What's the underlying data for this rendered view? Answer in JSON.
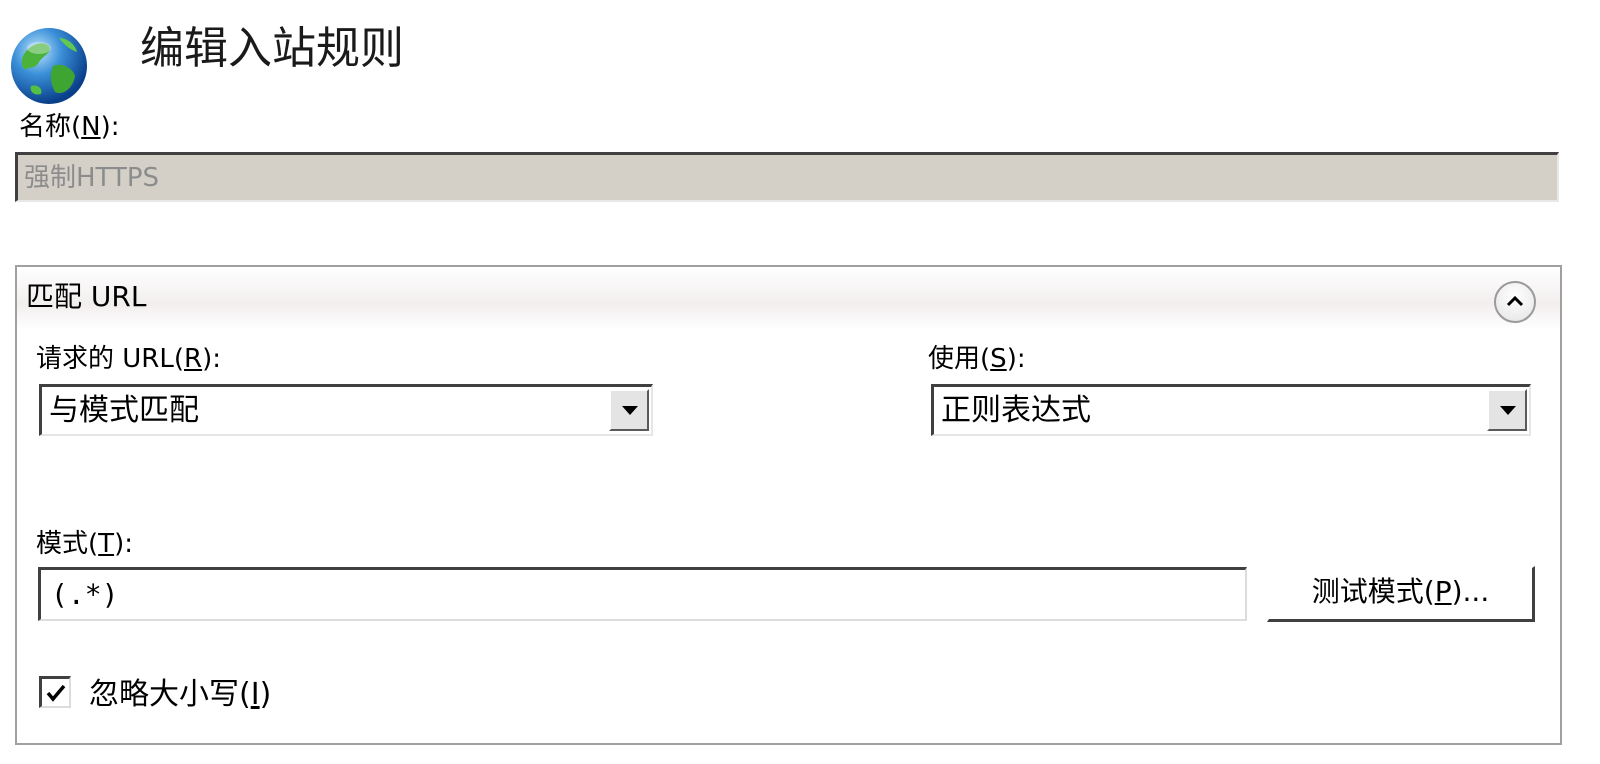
{
  "header": {
    "icon": "globe-icon",
    "title": "编辑入站规则"
  },
  "name": {
    "label": "名称",
    "mnemonic": "N",
    "value": "强制HTTPS",
    "disabled": true
  },
  "match_url": {
    "title": "匹配 URL",
    "collapse_icon": "chevron-up-icon",
    "requested_url": {
      "label": "请求的 URL",
      "mnemonic": "R",
      "value": "与模式匹配"
    },
    "using": {
      "label": "使用",
      "mnemonic": "S",
      "value": "正则表达式"
    },
    "pattern": {
      "label": "模式",
      "mnemonic": "T",
      "value": "(.*)"
    },
    "test_button": {
      "label": "测试模式",
      "mnemonic": "P",
      "suffix": "..."
    },
    "ignore_case": {
      "label": "忽略大小写",
      "mnemonic": "I",
      "checked": true
    }
  },
  "colors": {
    "disabled_field_bg": "#d4d0c8",
    "disabled_text": "#8c8c8c",
    "group_border": "#a0a0a0"
  }
}
